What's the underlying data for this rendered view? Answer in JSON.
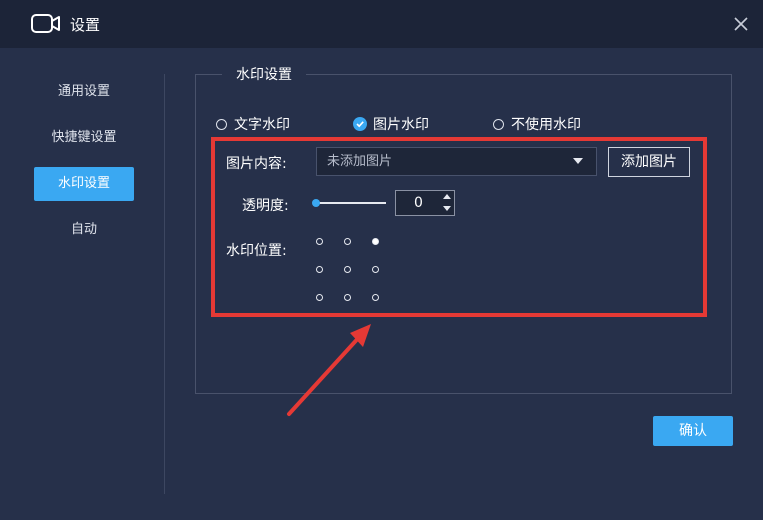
{
  "window": {
    "title": "设置",
    "icon": "video-camera-icon",
    "close_icon": "close-icon"
  },
  "sidebar": {
    "items": [
      {
        "label": "通用设置",
        "active": false
      },
      {
        "label": "快捷键设置",
        "active": false
      },
      {
        "label": "水印设置",
        "active": true
      },
      {
        "label": "自动",
        "active": false
      }
    ]
  },
  "watermark": {
    "group_title": "水印设置",
    "options": [
      {
        "label": "文字水印",
        "selected": false
      },
      {
        "label": "图片水印",
        "selected": true
      },
      {
        "label": "不使用水印",
        "selected": false
      }
    ],
    "image_content_label": "图片内容:",
    "image_select_value": "未添加图片",
    "add_image_button": "添加图片",
    "opacity_label": "透明度:",
    "opacity_value": "0",
    "position_label": "水印位置:",
    "position_selected": "top-right"
  },
  "footer": {
    "confirm_button": "确认"
  },
  "colors": {
    "accent": "#3aa8f2",
    "highlight": "#e53935",
    "background": "#26304a",
    "titlebar": "#1c2438"
  }
}
